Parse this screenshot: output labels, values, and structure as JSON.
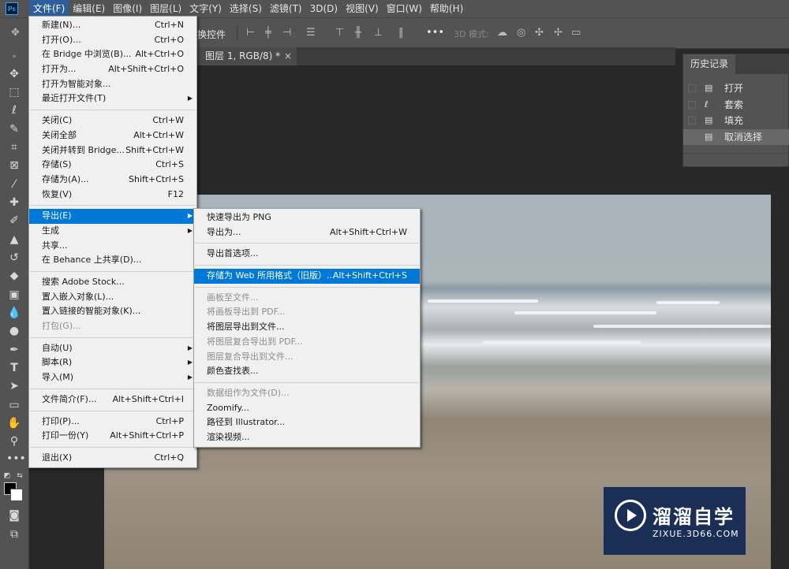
{
  "app": {
    "logo": "Ps"
  },
  "menubar": [
    "文件(F)",
    "编辑(E)",
    "图像(I)",
    "图层(L)",
    "文字(Y)",
    "选择(S)",
    "滤镜(T)",
    "3D(D)",
    "视图(V)",
    "窗口(W)",
    "帮助(H)"
  ],
  "options": {
    "transform_label": "换控件",
    "mode3d": "3D 模式:",
    "more": "•••"
  },
  "tab": {
    "title": "图层 1, RGB/8) *",
    "close": "×"
  },
  "history": {
    "title": "历史记录",
    "items": [
      {
        "label": "打开",
        "icon": "document-icon"
      },
      {
        "label": "套索",
        "icon": "lasso-icon"
      },
      {
        "label": "填充",
        "icon": "document-icon"
      },
      {
        "label": "取消选择",
        "icon": "document-icon"
      }
    ]
  },
  "file_menu": [
    {
      "label": "新建(N)...",
      "shortcut": "Ctrl+N"
    },
    {
      "label": "打开(O)...",
      "shortcut": "Ctrl+O"
    },
    {
      "label": "在 Bridge 中浏览(B)...",
      "shortcut": "Alt+Ctrl+O"
    },
    {
      "label": "打开为...",
      "shortcut": "Alt+Shift+Ctrl+O"
    },
    {
      "label": "打开为智能对象...",
      "shortcut": ""
    },
    {
      "label": "最近打开文件(T)",
      "shortcut": "",
      "submenu": true
    },
    {
      "sep": true
    },
    {
      "label": "关闭(C)",
      "shortcut": "Ctrl+W"
    },
    {
      "label": "关闭全部",
      "shortcut": "Alt+Ctrl+W"
    },
    {
      "label": "关闭并转到 Bridge...",
      "shortcut": "Shift+Ctrl+W"
    },
    {
      "label": "存储(S)",
      "shortcut": "Ctrl+S"
    },
    {
      "label": "存储为(A)...",
      "shortcut": "Shift+Ctrl+S"
    },
    {
      "label": "恢复(V)",
      "shortcut": "F12"
    },
    {
      "sep": true
    },
    {
      "label": "导出(E)",
      "shortcut": "",
      "submenu": true,
      "highlight": true
    },
    {
      "label": "生成",
      "shortcut": "",
      "submenu": true
    },
    {
      "label": "共享...",
      "shortcut": ""
    },
    {
      "label": "在 Behance 上共享(D)...",
      "shortcut": ""
    },
    {
      "sep": true
    },
    {
      "label": "搜索 Adobe Stock...",
      "shortcut": ""
    },
    {
      "label": "置入嵌入对象(L)...",
      "shortcut": ""
    },
    {
      "label": "置入链接的智能对象(K)...",
      "shortcut": ""
    },
    {
      "label": "打包(G)...",
      "shortcut": "",
      "disabled": true
    },
    {
      "sep": true
    },
    {
      "label": "自动(U)",
      "shortcut": "",
      "submenu": true
    },
    {
      "label": "脚本(R)",
      "shortcut": "",
      "submenu": true
    },
    {
      "label": "导入(M)",
      "shortcut": "",
      "submenu": true
    },
    {
      "sep": true
    },
    {
      "label": "文件简介(F)...",
      "shortcut": "Alt+Shift+Ctrl+I"
    },
    {
      "sep": true
    },
    {
      "label": "打印(P)...",
      "shortcut": "Ctrl+P"
    },
    {
      "label": "打印一份(Y)",
      "shortcut": "Alt+Shift+Ctrl+P"
    },
    {
      "sep": true
    },
    {
      "label": "退出(X)",
      "shortcut": "Ctrl+Q"
    }
  ],
  "export_menu": [
    {
      "label": "快速导出为 PNG",
      "shortcut": ""
    },
    {
      "label": "导出为...",
      "shortcut": "Alt+Shift+Ctrl+W"
    },
    {
      "sep": true
    },
    {
      "label": "导出首选项...",
      "shortcut": ""
    },
    {
      "sep": true
    },
    {
      "label": "存储为 Web 所用格式（旧版）...",
      "shortcut": "Alt+Shift+Ctrl+S",
      "highlight": true
    },
    {
      "sep": true
    },
    {
      "label": "画板至文件...",
      "shortcut": "",
      "disabled": true
    },
    {
      "label": "将画板导出到 PDF...",
      "shortcut": "",
      "disabled": true
    },
    {
      "label": "将图层导出到文件...",
      "shortcut": ""
    },
    {
      "label": "将图层复合导出到 PDF...",
      "shortcut": "",
      "disabled": true
    },
    {
      "label": "图层复合导出到文件...",
      "shortcut": "",
      "disabled": true
    },
    {
      "label": "颜色查找表...",
      "shortcut": ""
    },
    {
      "sep": true
    },
    {
      "label": "数据组作为文件(D)...",
      "shortcut": "",
      "disabled": true
    },
    {
      "label": "Zoomify...",
      "shortcut": ""
    },
    {
      "label": "路径到 Illustrator...",
      "shortcut": ""
    },
    {
      "label": "渲染视频...",
      "shortcut": ""
    }
  ],
  "watermark": {
    "name": "溜溜自学",
    "url": "ZIXUE.3D66.COM"
  },
  "colors": {
    "highlight": "#0078d7",
    "ui_dark": "#535353",
    "watermark_bg": "#1b2e55"
  }
}
